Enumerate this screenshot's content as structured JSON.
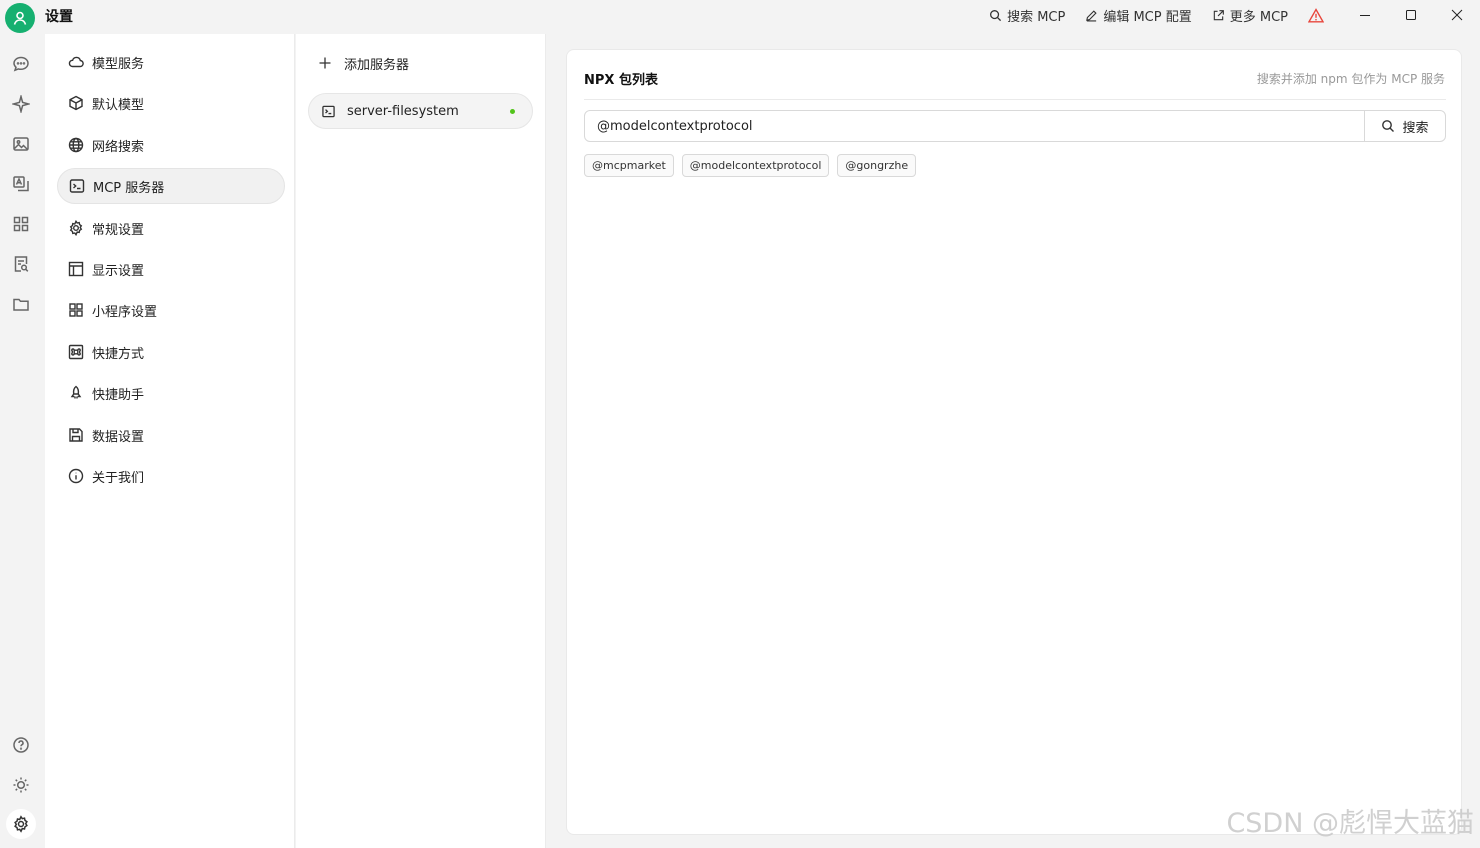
{
  "app": {
    "title": "设置"
  },
  "titlebar": {
    "search_mcp": "搜索 MCP",
    "edit_mcp": "编辑 MCP 配置",
    "more_mcp": "更多 MCP"
  },
  "menu": {
    "items": [
      {
        "label": "模型服务",
        "icon": "cloud-icon"
      },
      {
        "label": "默认模型",
        "icon": "cube-icon"
      },
      {
        "label": "网络搜索",
        "icon": "globe-icon"
      },
      {
        "label": "MCP 服务器",
        "icon": "terminal-icon",
        "active": true
      },
      {
        "label": "常规设置",
        "icon": "gear-icon"
      },
      {
        "label": "显示设置",
        "icon": "layout-icon"
      },
      {
        "label": "小程序设置",
        "icon": "grid-icon"
      },
      {
        "label": "快捷方式",
        "icon": "command-icon"
      },
      {
        "label": "快捷助手",
        "icon": "rocket-icon"
      },
      {
        "label": "数据设置",
        "icon": "save-icon"
      },
      {
        "label": "关于我们",
        "icon": "info-icon"
      }
    ]
  },
  "servers": {
    "add_label": "添加服务器",
    "items": [
      {
        "name": "server-filesystem",
        "status": "active",
        "status_color": "#52c41a"
      }
    ]
  },
  "npx": {
    "title": "NPX 包列表",
    "hint": "搜索并添加 npm 包作为 MCP 服务",
    "search_value": "@modelcontextprotocol",
    "search_button": "搜索",
    "tags": [
      "@mcpmarket",
      "@modelcontextprotocol",
      "@gongrzhe"
    ]
  },
  "watermark": "CSDN @彪悍大蓝猫",
  "colors": {
    "avatar": "#16b070",
    "warning": "#e8463c",
    "status_active": "#52c41a"
  }
}
